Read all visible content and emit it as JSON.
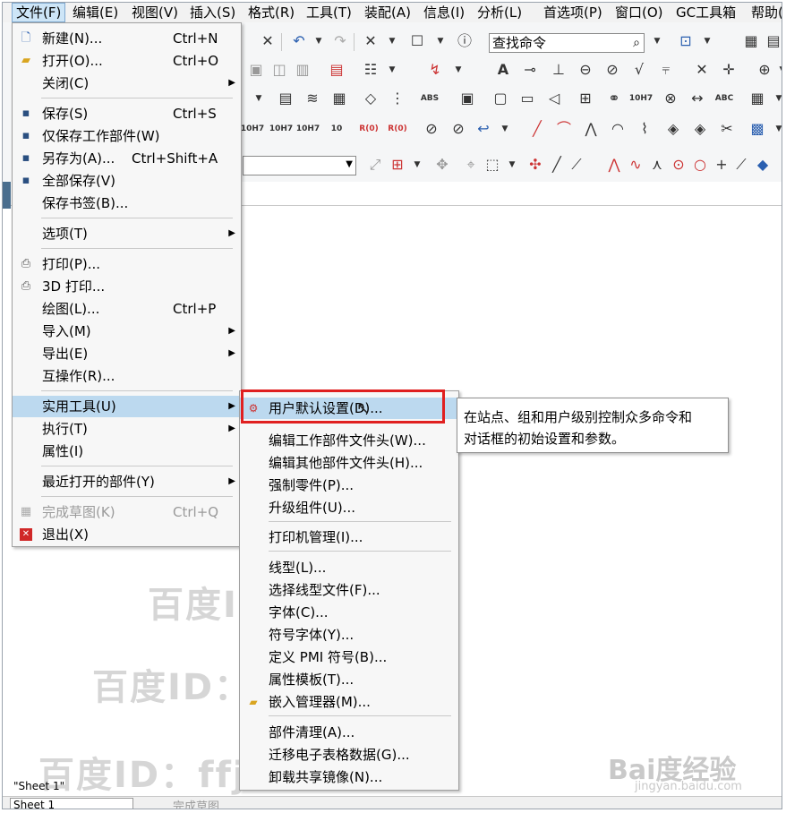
{
  "menubar": {
    "items": [
      {
        "label": "文件(F)"
      },
      {
        "label": "编辑(E)"
      },
      {
        "label": "视图(V)"
      },
      {
        "label": "插入(S)"
      },
      {
        "label": "格式(R)"
      },
      {
        "label": "工具(T)"
      },
      {
        "label": "装配(A)"
      },
      {
        "label": "信息(I)"
      },
      {
        "label": "分析(L)"
      },
      {
        "label": "首选项(P)"
      },
      {
        "label": "窗口(O)"
      },
      {
        "label": "GC工具箱"
      },
      {
        "label": "帮助("
      }
    ]
  },
  "toolbar": {
    "search_placeholder": "查找命令",
    "labels": {
      "tol_a": "10H7",
      "tol_b": "10H7",
      "tol_c": "10H7",
      "tol_d": "10",
      "abc": "ABC",
      "abs": "ABS",
      "r0": "R(0)",
      "r1": "R(0)",
      "tol_e": "10H7"
    }
  },
  "file_menu": {
    "items": [
      {
        "icon": "new-doc-icon",
        "label": "新建(N)...",
        "shortcut": "Ctrl+N"
      },
      {
        "icon": "open-folder-icon",
        "label": "打开(O)...",
        "shortcut": "Ctrl+O"
      },
      {
        "icon": "",
        "label": "关闭(C)",
        "shortcut": "",
        "submenu": true
      },
      {
        "icon": "save-icon",
        "label": "保存(S)",
        "shortcut": "Ctrl+S"
      },
      {
        "icon": "save-work-icon",
        "label": "仅保存工作部件(W)",
        "shortcut": ""
      },
      {
        "icon": "save-as-icon",
        "label": "另存为(A)...",
        "shortcut": "Ctrl+Shift+A"
      },
      {
        "icon": "save-all-icon",
        "label": "全部保存(V)",
        "shortcut": ""
      },
      {
        "icon": "",
        "label": "保存书签(B)...",
        "shortcut": ""
      },
      {
        "icon": "",
        "label": "选项(T)",
        "shortcut": "",
        "submenu": true
      },
      {
        "icon": "print-icon",
        "label": "打印(P)...",
        "shortcut": ""
      },
      {
        "icon": "print-3d-icon",
        "label": "3D 打印...",
        "shortcut": ""
      },
      {
        "icon": "",
        "label": "绘图(L)...",
        "shortcut": "Ctrl+P"
      },
      {
        "icon": "",
        "label": "导入(M)",
        "shortcut": "",
        "submenu": true
      },
      {
        "icon": "",
        "label": "导出(E)",
        "shortcut": "",
        "submenu": true
      },
      {
        "icon": "",
        "label": "互操作(R)...",
        "shortcut": ""
      },
      {
        "icon": "",
        "label": "实用工具(U)",
        "shortcut": "",
        "submenu": true,
        "highlighted": true
      },
      {
        "icon": "",
        "label": "执行(T)",
        "shortcut": "",
        "submenu": true
      },
      {
        "icon": "",
        "label": "属性(I)",
        "shortcut": ""
      },
      {
        "icon": "",
        "label": "最近打开的部件(Y)",
        "shortcut": "",
        "submenu": true
      },
      {
        "icon": "finish-sketch-icon",
        "label": "完成草图(K)",
        "shortcut": "Ctrl+Q",
        "disabled": true
      },
      {
        "icon": "exit-icon",
        "label": "退出(X)",
        "shortcut": ""
      }
    ]
  },
  "utilities_menu": {
    "items": [
      {
        "icon": "user-defaults-icon",
        "label": "用户默认设置(D)...",
        "highlighted": true
      },
      {
        "icon": "",
        "label": "编辑工作部件文件头(W)..."
      },
      {
        "icon": "",
        "label": "编辑其他部件文件头(H)..."
      },
      {
        "icon": "",
        "label": "强制零件(P)..."
      },
      {
        "icon": "",
        "label": "升级组件(U)..."
      },
      {
        "icon": "",
        "label": "打印机管理(I)..."
      },
      {
        "icon": "",
        "label": "线型(L)..."
      },
      {
        "icon": "",
        "label": "选择线型文件(F)..."
      },
      {
        "icon": "",
        "label": "字体(C)..."
      },
      {
        "icon": "",
        "label": "符号字体(Y)..."
      },
      {
        "icon": "",
        "label": "定义 PMI 符号(B)..."
      },
      {
        "icon": "",
        "label": "属性模板(T)..."
      },
      {
        "icon": "embed-manager-icon",
        "label": "嵌入管理器(M)..."
      },
      {
        "icon": "",
        "label": "部件清理(A)..."
      },
      {
        "icon": "",
        "label": "迁移电子表格数据(G)..."
      },
      {
        "icon": "",
        "label": "卸载共享镜像(N)..."
      }
    ]
  },
  "tooltip": {
    "line1": "在站点、组和用户级别控制众多命令和",
    "line2": "对话框的初始设置和参数。"
  },
  "watermark": {
    "text1": "百度ID：ffjczr",
    "text2": "百度ID：ffjczr",
    "text3": "百度ID：ffjczr",
    "brand": "Bai度经验",
    "brand_url": "jingyan.baidu.com"
  },
  "status": {
    "sheet_label": "\"Sheet 1\"",
    "sheet_combo": "Sheet 1",
    "finish_sketch": "完成草图"
  },
  "colors": {
    "highlight": "#bcd9ef",
    "red_box": "#e02020",
    "menu_bg": "#f7f7f7"
  }
}
